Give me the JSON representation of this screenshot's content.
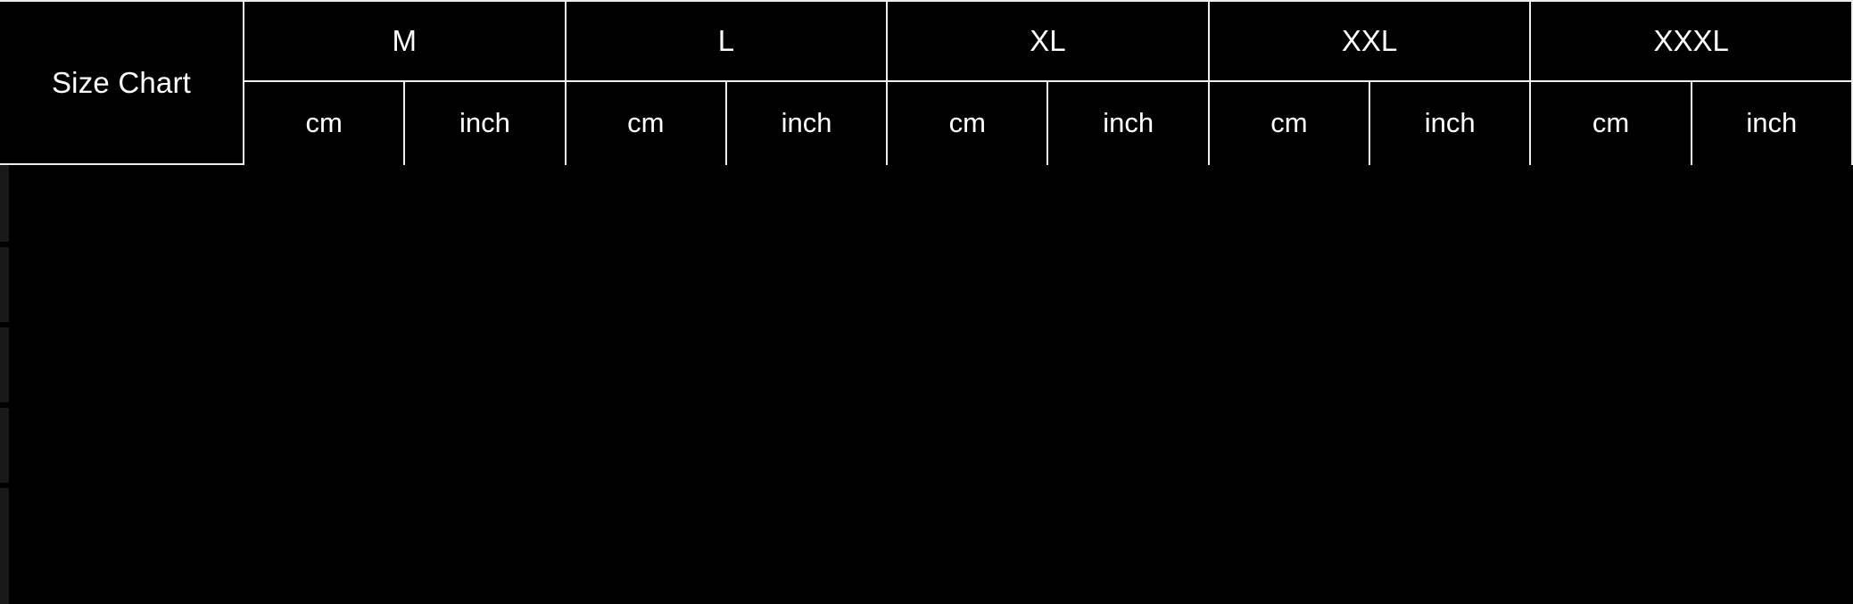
{
  "table": {
    "corner_label": "Size Chart",
    "size_groups": [
      "M",
      "L",
      "XL",
      "XXL",
      "XXXL"
    ],
    "unit_headers": [
      "cm",
      "inch"
    ],
    "columns": [
      {
        "size": "M",
        "units": [
          "cm",
          "inch"
        ]
      },
      {
        "size": "L",
        "units": [
          "cm",
          "inch"
        ]
      },
      {
        "size": "XL",
        "units": [
          "cm",
          "inch"
        ]
      },
      {
        "size": "XXL",
        "units": [
          "cm",
          "inch"
        ]
      },
      {
        "size": "XXXL",
        "units": [
          "cm",
          "inch"
        ]
      }
    ],
    "rows": [
      {
        "label": "",
        "values": [
          "",
          "",
          "",
          "",
          "",
          "",
          "",
          "",
          "",
          ""
        ]
      },
      {
        "label": "",
        "values": [
          "",
          "",
          "",
          "",
          "",
          "",
          "",
          "",
          "",
          ""
        ]
      },
      {
        "label": "",
        "values": [
          "",
          "",
          "",
          "",
          "",
          "",
          "",
          "",
          "",
          ""
        ]
      },
      {
        "label": "",
        "values": [
          "",
          "",
          "",
          "",
          "",
          "",
          "",
          "",
          "",
          ""
        ]
      },
      {
        "label": "",
        "values": [
          "",
          "",
          "",
          "",
          "",
          "",
          "",
          "",
          "",
          ""
        ]
      }
    ]
  },
  "colors": {
    "background": "#000000",
    "border": "#ededed",
    "text": "#ffffff",
    "hidden_text": "#000000",
    "edge_artifact": "#191919"
  }
}
